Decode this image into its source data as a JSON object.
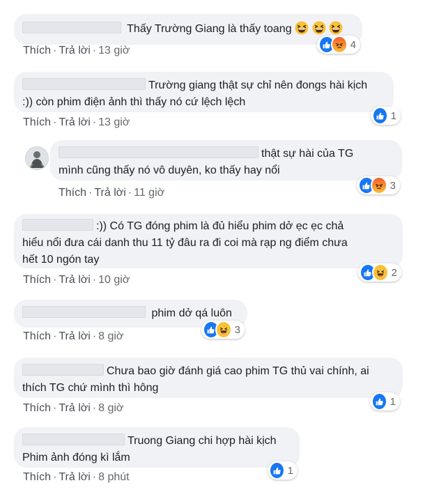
{
  "actions": {
    "like": "Thích",
    "reply": "Trả lời",
    "separator": "·"
  },
  "comments": [
    {
      "text": "Thấy Trường Giang là thấy toang",
      "time": "13 giờ",
      "reaction_count": "4",
      "reactions": [
        "like-icon",
        "angry-icon"
      ],
      "trailing_emoji": [
        "laughing-emoji",
        "laughing-emoji",
        "laughing-emoji"
      ]
    },
    {
      "text_line1": "Trường giang thật sự chỉ nên đongs hài kịch",
      "text_line2": ":)) còn phim điện ảnh thì thấy nó cứ lệch lệch",
      "time": "13 giờ",
      "reaction_count": "1",
      "reactions": [
        "like-icon"
      ]
    },
    {
      "text_line1": "thật sự hài của TG",
      "text_line2": "mình cũng thấy nó vô duyên, ko thấy hay nổi",
      "time": "11 giờ",
      "reaction_count": "3",
      "reactions": [
        "like-icon",
        "angry-icon"
      ],
      "reply": true
    },
    {
      "text_line1": ":)) Có TG đóng phim là đủ hiểu phim dở ẹc ẹc chả",
      "text_line2": "hiểu nổi đưa cái danh thu 11 tỷ đâu ra đi coi mà rạp ng điểm chưa",
      "text_line3": "hết 10 ngón tay",
      "time": "10 giờ",
      "reaction_count": "2",
      "reactions": [
        "like-icon",
        "haha-icon"
      ]
    },
    {
      "text": "phim dở qá luôn",
      "time": "8 giờ",
      "reaction_count": "3",
      "reactions": [
        "like-icon",
        "haha-icon"
      ]
    },
    {
      "text_line1": "Chưa bao giờ đánh giá cao phim TG thủ vai chính, ai",
      "text_line2": "thích TG chứ mình thì hông",
      "time": "8 giờ",
      "reaction_count": "1",
      "reactions": [
        "like-icon"
      ]
    },
    {
      "text_line1": "Truong Giang chi hợp hài kịch",
      "text_line2": "Phim ảnh đóng kì lắm",
      "time": "8 phút",
      "reaction_count": "1",
      "reactions": [
        "like-icon"
      ]
    }
  ],
  "colors": {
    "like": "#1877f2",
    "bubble": "#f0f2f5",
    "meta": "#65676b"
  }
}
